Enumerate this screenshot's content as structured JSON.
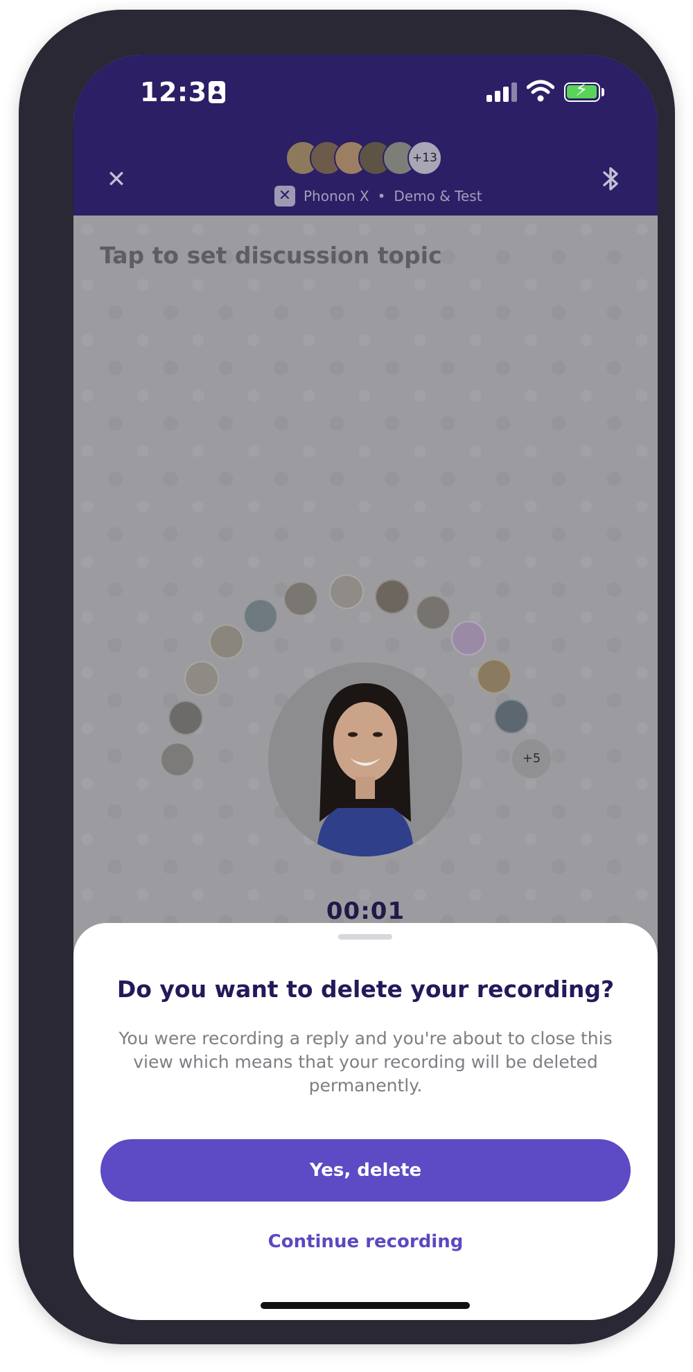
{
  "status_bar": {
    "time": "12:32"
  },
  "header": {
    "participants_more": "+13",
    "team_name": "Phonon X",
    "separator": "•",
    "channel_name": "Demo & Test",
    "close_icon": "close-icon",
    "bluetooth_icon": "bluetooth-icon"
  },
  "content": {
    "topic_placeholder": "Tap to set discussion topic",
    "more_speakers": "+5",
    "timer": "00:01"
  },
  "dialog": {
    "title": "Do you want to delete your recording?",
    "body": "You were recording a reply and you're about to close this view which means that your recording will be deleted permanently.",
    "primary_label": "Yes, delete",
    "secondary_label": "Continue recording"
  },
  "colors": {
    "header_bg": "#2c1f66",
    "primary_button": "#5c4bc4",
    "title_text": "#221a5a",
    "battery_green": "#5ad35a"
  }
}
